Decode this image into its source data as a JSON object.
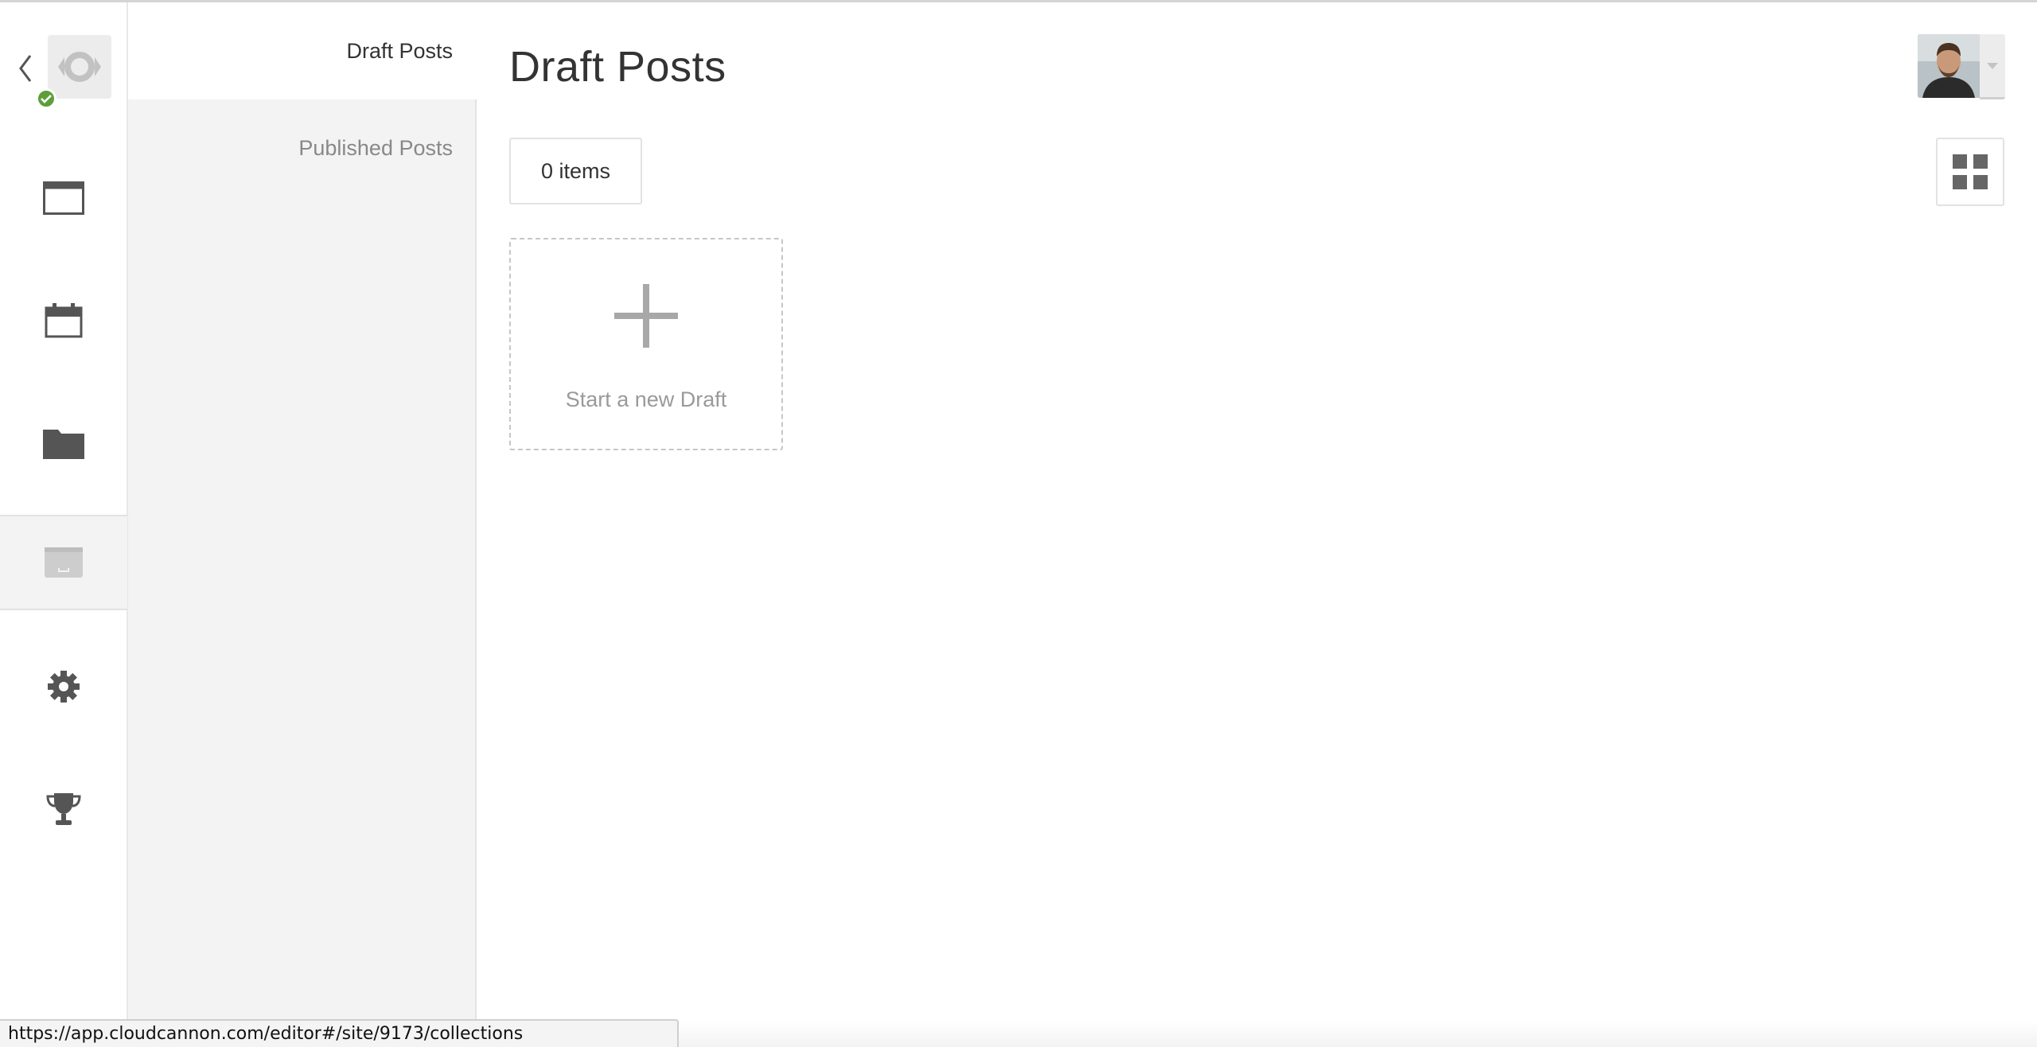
{
  "rail": {
    "items": [
      {
        "icon": "browser-window-icon"
      },
      {
        "icon": "calendar-icon"
      },
      {
        "icon": "folder-icon"
      },
      {
        "icon": "archive-box-icon",
        "active": true
      },
      {
        "icon": "gear-icon"
      },
      {
        "icon": "trophy-icon"
      }
    ]
  },
  "panel": {
    "items": [
      {
        "label": "Draft Posts",
        "active": true
      },
      {
        "label": "Published Posts",
        "active": false
      }
    ]
  },
  "main": {
    "title": "Draft Posts",
    "items_count": "0 items",
    "new_draft_label": "Start a new Draft"
  },
  "status_bar": {
    "url": "https://app.cloudcannon.com/editor#/site/9173/collections"
  },
  "colors": {
    "accent_green": "#5d9e3a",
    "panel_bg": "#f3f3f3",
    "icon_gray": "#555555"
  }
}
